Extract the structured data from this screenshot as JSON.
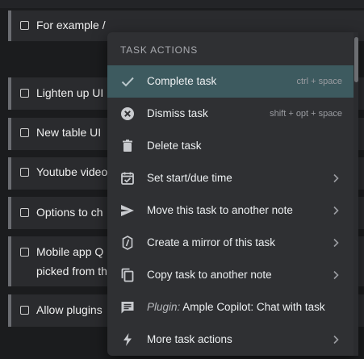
{
  "tasks": [
    {
      "text": "For example /"
    },
    {
      "text": "Lighten up UI"
    },
    {
      "text": "New table UI"
    },
    {
      "text": "Youtube video"
    },
    {
      "text": "Options to ch"
    },
    {
      "text": "Mobile app Q",
      "text2": "picked from th"
    },
    {
      "text": "Allow plugins"
    }
  ],
  "menu": {
    "header": "TASK ACTIONS",
    "items": [
      {
        "label": "Complete task",
        "shortcut": "ctrl + space",
        "icon": "check-icon",
        "active": true
      },
      {
        "label": "Dismiss task",
        "shortcut": "shift + opt + space",
        "icon": "dismiss-icon"
      },
      {
        "label": "Delete task",
        "icon": "trash-icon"
      },
      {
        "label": "Set start/due time",
        "icon": "calendar-check-icon",
        "submenu": true
      },
      {
        "label": "Move this task to another note",
        "icon": "send-icon",
        "submenu": true
      },
      {
        "label": "Create a mirror of this task",
        "icon": "mirror-icon",
        "submenu": true
      },
      {
        "label": "Copy task to another note",
        "icon": "copy-icon",
        "submenu": true
      },
      {
        "prefix": "Plugin:",
        "label": "Ample Copilot: Chat with task",
        "icon": "chat-icon"
      },
      {
        "label": "More task actions",
        "icon": "bolt-icon",
        "submenu": true
      }
    ]
  },
  "colors": {
    "background": "#1b1c1e",
    "menu_background": "#2f3033",
    "active_row": "#3d5a5f",
    "text": "#eceff1",
    "muted_text": "#9a9ca1"
  }
}
